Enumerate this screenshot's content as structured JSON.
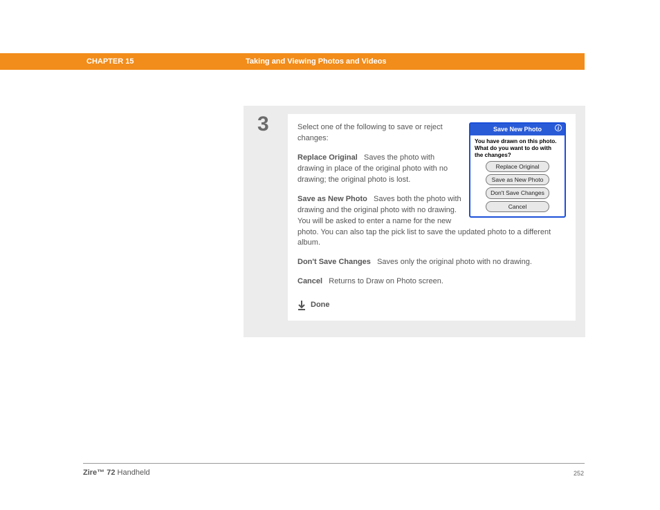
{
  "header": {
    "chapter": "CHAPTER 15",
    "title": "Taking and Viewing Photos and Videos"
  },
  "step": {
    "number": "3",
    "intro": "Select one of the following to save or reject changes:",
    "options": {
      "replace": {
        "label": "Replace Original",
        "desc": "Saves the photo with drawing in place of the original photo with no drawing; the original photo is lost."
      },
      "saveas": {
        "label": "Save as New Photo",
        "desc": "Saves both the photo with drawing and the original photo with no drawing. You will be asked to enter a name for the new photo. You can also tap the pick list to save the updated photo to a different album."
      },
      "dont": {
        "label": "Don't Save Changes",
        "desc": "Saves only the original photo with no drawing."
      },
      "cancel": {
        "label": "Cancel",
        "desc": "Returns to Draw on Photo screen."
      }
    },
    "done": "Done"
  },
  "dialog": {
    "title": "Save New Photo",
    "message": "You have drawn on this photo. What do you want to do with the changes?",
    "buttons": [
      "Replace Original",
      "Save as New Photo",
      "Don't Save Changes",
      "Cancel"
    ]
  },
  "footer": {
    "product": "Zire™ 72",
    "suffix": "Handheld",
    "page": "252"
  }
}
